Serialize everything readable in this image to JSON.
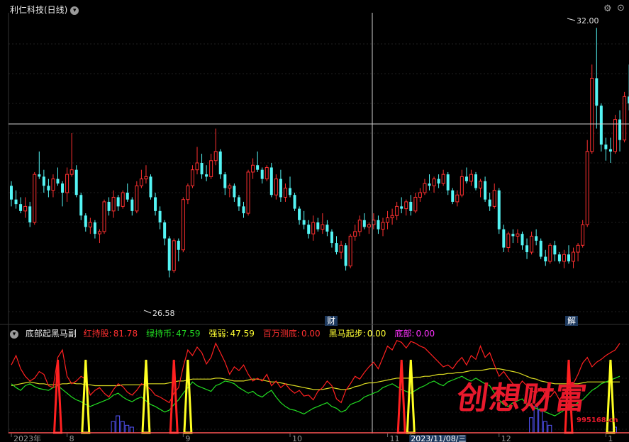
{
  "header": {
    "title": "利仁科技(日线)"
  },
  "sub_header": {
    "name": "底部起黑马副",
    "items": [
      {
        "label": "红持股:",
        "value": "81.78",
        "color": "#ff3030"
      },
      {
        "label": "绿持币:",
        "value": "47.59",
        "color": "#22dd22"
      },
      {
        "label": "强弱:",
        "value": "47.59",
        "color": "#ffff33"
      },
      {
        "label": "百万测底:",
        "value": "0.00",
        "color": "#ff3030"
      },
      {
        "label": "黑马起步:",
        "value": "0.00",
        "color": "#ffff33"
      },
      {
        "label": "底部:",
        "value": "0.00",
        "color": "#ff33ff"
      }
    ]
  },
  "events": {
    "e1": "财",
    "e2": "解"
  },
  "watermark": {
    "text": "创想财富",
    "url": "995168.cn"
  },
  "chart_data": {
    "type": "candlestick",
    "y_range": [
      25.8,
      32.3
    ],
    "high_label": "32.00",
    "low_label": "26.58",
    "x_ticks": [
      {
        "label": "2023年",
        "index": 0
      },
      {
        "label": "8",
        "index": 12
      },
      {
        "label": "9",
        "index": 37
      },
      {
        "label": "10",
        "index": 60
      },
      {
        "label": "11",
        "index": 81
      },
      {
        "label": "2023/11/08/三",
        "index": 86
      },
      {
        "label": "12",
        "index": 105
      },
      {
        "label": "1",
        "index": 128
      }
    ],
    "colors": {
      "up": "#ff3030",
      "down": "#54f5f5",
      "rsi_red": "#ff2020",
      "rsi_green": "#22dd22",
      "yellow": "#dddd22",
      "blue": "#5555ff"
    },
    "ohlc": [
      [
        28.55,
        28.65,
        28.1,
        28.25
      ],
      [
        28.25,
        28.45,
        28.05,
        28.15
      ],
      [
        28.15,
        28.3,
        27.95,
        28.0
      ],
      [
        28.0,
        28.3,
        27.85,
        28.1
      ],
      [
        28.1,
        28.2,
        27.65,
        27.75
      ],
      [
        27.75,
        28.85,
        27.7,
        28.8
      ],
      [
        28.8,
        29.3,
        28.7,
        28.75
      ],
      [
        28.75,
        28.9,
        28.4,
        28.55
      ],
      [
        28.55,
        28.7,
        28.3,
        28.45
      ],
      [
        28.45,
        28.8,
        28.3,
        28.7
      ],
      [
        28.7,
        28.95,
        28.55,
        28.6
      ],
      [
        28.6,
        28.65,
        28.1,
        28.4
      ],
      [
        28.4,
        28.95,
        28.2,
        28.8
      ],
      [
        28.8,
        29.7,
        28.75,
        28.9
      ],
      [
        28.9,
        29.0,
        28.3,
        28.35
      ],
      [
        28.35,
        28.4,
        27.8,
        27.9
      ],
      [
        27.9,
        27.95,
        27.55,
        27.65
      ],
      [
        27.65,
        27.85,
        27.5,
        27.75
      ],
      [
        27.75,
        27.8,
        27.4,
        27.5
      ],
      [
        27.5,
        27.6,
        27.3,
        27.55
      ],
      [
        27.55,
        28.25,
        27.5,
        28.2
      ],
      [
        28.2,
        28.3,
        27.9,
        28.0
      ],
      [
        28.0,
        28.45,
        27.85,
        28.3
      ],
      [
        28.3,
        28.35,
        28.0,
        28.1
      ],
      [
        28.1,
        28.45,
        28.05,
        28.4
      ],
      [
        28.4,
        28.6,
        28.2,
        28.25
      ],
      [
        28.25,
        28.3,
        27.9,
        28.0
      ],
      [
        28.0,
        28.65,
        27.95,
        28.55
      ],
      [
        28.55,
        28.9,
        28.5,
        28.7
      ],
      [
        28.7,
        29.0,
        28.6,
        28.75
      ],
      [
        28.75,
        28.8,
        28.25,
        28.3
      ],
      [
        28.3,
        28.4,
        27.9,
        28.0
      ],
      [
        28.0,
        28.1,
        27.6,
        27.75
      ],
      [
        27.75,
        27.8,
        27.25,
        27.4
      ],
      [
        27.4,
        27.45,
        26.55,
        26.7
      ],
      [
        26.7,
        27.4,
        26.65,
        27.35
      ],
      [
        27.35,
        27.4,
        26.9,
        27.15
      ],
      [
        27.15,
        28.3,
        27.1,
        28.25
      ],
      [
        28.25,
        28.6,
        28.15,
        28.55
      ],
      [
        28.55,
        29.0,
        28.5,
        28.9
      ],
      [
        28.9,
        29.4,
        28.8,
        29.05
      ],
      [
        29.05,
        29.25,
        28.7,
        28.8
      ],
      [
        28.8,
        29.0,
        28.65,
        28.75
      ],
      [
        28.75,
        29.25,
        28.7,
        29.1
      ],
      [
        29.1,
        29.8,
        29.0,
        29.3
      ],
      [
        29.3,
        29.35,
        28.7,
        28.8
      ],
      [
        28.8,
        28.85,
        28.35,
        28.5
      ],
      [
        28.5,
        28.6,
        28.3,
        28.55
      ],
      [
        28.55,
        28.6,
        28.2,
        28.3
      ],
      [
        28.3,
        28.35,
        28.0,
        28.1
      ],
      [
        28.1,
        28.2,
        27.85,
        27.95
      ],
      [
        27.95,
        28.9,
        27.9,
        28.85
      ],
      [
        28.85,
        29.15,
        28.7,
        29.0
      ],
      [
        29.0,
        29.3,
        28.85,
        28.9
      ],
      [
        28.9,
        28.95,
        28.6,
        28.7
      ],
      [
        28.7,
        29.0,
        28.65,
        28.95
      ],
      [
        28.95,
        29.05,
        28.3,
        28.35
      ],
      [
        28.35,
        28.8,
        28.25,
        28.7
      ],
      [
        28.7,
        28.9,
        28.2,
        28.3
      ],
      [
        28.3,
        28.6,
        28.2,
        28.5
      ],
      [
        28.5,
        28.75,
        28.3,
        28.35
      ],
      [
        28.35,
        28.4,
        28.0,
        28.05
      ],
      [
        28.05,
        28.1,
        27.7,
        27.8
      ],
      [
        27.8,
        28.0,
        27.6,
        27.7
      ],
      [
        27.7,
        27.8,
        27.4,
        27.5
      ],
      [
        27.5,
        27.9,
        27.35,
        27.75
      ],
      [
        27.75,
        27.85,
        27.55,
        27.6
      ],
      [
        27.6,
        27.95,
        27.5,
        27.7
      ],
      [
        27.7,
        27.8,
        27.45,
        27.55
      ],
      [
        27.55,
        27.6,
        27.2,
        27.3
      ],
      [
        27.3,
        27.45,
        27.05,
        27.1
      ],
      [
        27.1,
        27.35,
        26.95,
        27.25
      ],
      [
        27.25,
        27.3,
        26.7,
        26.8
      ],
      [
        26.8,
        27.5,
        26.75,
        27.45
      ],
      [
        27.45,
        27.7,
        27.35,
        27.55
      ],
      [
        27.55,
        27.9,
        27.45,
        27.8
      ],
      [
        27.8,
        27.95,
        27.6,
        27.65
      ],
      [
        27.65,
        27.75,
        27.5,
        27.7
      ],
      [
        27.7,
        27.95,
        27.6,
        27.8
      ],
      [
        27.8,
        27.9,
        27.5,
        27.6
      ],
      [
        27.6,
        27.85,
        27.45,
        27.75
      ],
      [
        27.75,
        28.0,
        27.6,
        27.85
      ],
      [
        27.85,
        28.05,
        27.7,
        27.9
      ],
      [
        27.9,
        28.2,
        27.8,
        28.1
      ],
      [
        28.1,
        28.3,
        27.95,
        28.05
      ],
      [
        28.05,
        28.25,
        27.9,
        28.2
      ],
      [
        28.2,
        28.35,
        27.9,
        28.0
      ],
      [
        28.0,
        28.4,
        27.95,
        28.3
      ],
      [
        28.3,
        28.5,
        28.2,
        28.4
      ],
      [
        28.4,
        28.7,
        28.35,
        28.6
      ],
      [
        28.6,
        28.8,
        28.45,
        28.55
      ],
      [
        28.55,
        28.75,
        28.4,
        28.7
      ],
      [
        28.7,
        28.8,
        28.5,
        28.6
      ],
      [
        28.6,
        28.9,
        28.55,
        28.8
      ],
      [
        28.8,
        28.85,
        28.35,
        28.45
      ],
      [
        28.45,
        28.5,
        28.15,
        28.2
      ],
      [
        28.2,
        28.45,
        28.1,
        28.35
      ],
      [
        28.35,
        28.9,
        28.3,
        28.75
      ],
      [
        28.75,
        28.95,
        28.6,
        28.65
      ],
      [
        28.65,
        28.9,
        28.55,
        28.8
      ],
      [
        28.8,
        28.85,
        28.45,
        28.5
      ],
      [
        28.5,
        28.7,
        28.3,
        28.65
      ],
      [
        28.65,
        28.75,
        28.2,
        28.25
      ],
      [
        28.25,
        28.4,
        28.0,
        28.1
      ],
      [
        28.1,
        28.6,
        28.05,
        28.45
      ],
      [
        28.45,
        28.5,
        27.5,
        27.6
      ],
      [
        27.6,
        27.7,
        27.1,
        27.2
      ],
      [
        27.2,
        27.55,
        27.1,
        27.5
      ],
      [
        27.5,
        27.6,
        27.3,
        27.45
      ],
      [
        27.45,
        27.6,
        27.3,
        27.5
      ],
      [
        27.5,
        27.55,
        27.15,
        27.25
      ],
      [
        27.25,
        27.4,
        26.95,
        27.1
      ],
      [
        27.1,
        27.55,
        27.05,
        27.45
      ],
      [
        27.45,
        27.6,
        27.25,
        27.35
      ],
      [
        27.35,
        27.4,
        26.95,
        27.0
      ],
      [
        27.0,
        27.15,
        26.8,
        26.9
      ],
      [
        26.9,
        27.3,
        26.85,
        27.25
      ],
      [
        27.25,
        27.35,
        26.9,
        27.05
      ],
      [
        27.05,
        27.1,
        26.85,
        26.9
      ],
      [
        26.9,
        27.15,
        26.75,
        27.05
      ],
      [
        27.05,
        27.25,
        26.85,
        26.9
      ],
      [
        26.9,
        27.2,
        26.75,
        27.1
      ],
      [
        27.1,
        27.3,
        26.9,
        27.25
      ],
      [
        27.25,
        27.8,
        27.2,
        27.7
      ],
      [
        27.7,
        29.55,
        27.65,
        29.3
      ],
      [
        29.3,
        31.2,
        29.25,
        30.9
      ],
      [
        30.9,
        32.0,
        29.8,
        30.3
      ],
      [
        30.3,
        30.35,
        29.3,
        29.45
      ],
      [
        29.45,
        29.6,
        29.1,
        29.35
      ],
      [
        29.35,
        29.6,
        29.05,
        29.3
      ],
      [
        29.3,
        30.1,
        29.25,
        30.0
      ],
      [
        30.0,
        30.2,
        29.3,
        29.55
      ],
      [
        29.55,
        30.6,
        29.5,
        30.5
      ],
      [
        30.5,
        31.2,
        30.2,
        30.35
      ],
      [
        30.35,
        31.3,
        29.7,
        31.25
      ]
    ],
    "rsi_red": [
      72,
      82,
      68,
      60,
      55,
      58,
      65,
      62,
      50,
      48,
      80,
      88,
      60,
      52,
      55,
      60,
      57,
      40,
      45,
      48,
      42,
      38,
      46,
      52,
      49,
      43,
      40,
      45,
      52,
      50,
      46,
      40,
      38,
      35,
      32,
      42,
      48,
      70,
      88,
      82,
      91,
      85,
      73,
      80,
      95,
      85,
      75,
      62,
      70,
      66,
      72,
      62,
      55,
      58,
      55,
      62,
      50,
      55,
      48,
      52,
      46,
      42,
      45,
      39,
      40,
      35,
      44,
      48,
      55,
      50,
      36,
      32,
      45,
      52,
      60,
      57,
      64,
      70,
      75,
      68,
      80,
      92,
      88,
      98,
      96,
      90,
      97,
      95,
      92,
      90,
      85,
      80,
      75,
      70,
      72,
      68,
      75,
      80,
      72,
      82,
      78,
      92,
      80,
      85,
      72,
      60,
      65,
      58,
      52,
      48,
      55,
      50,
      45,
      42,
      48,
      40,
      38,
      44,
      35,
      42,
      48,
      52,
      62,
      74,
      80,
      70,
      75,
      78,
      82,
      85,
      88,
      95
    ],
    "rsi_green": [
      52,
      48,
      45,
      50,
      52,
      49,
      47,
      46,
      45,
      48,
      50,
      46,
      42,
      38,
      35,
      33,
      30,
      28,
      30,
      32,
      34,
      36,
      40,
      42,
      38,
      35,
      33,
      36,
      38,
      34,
      30,
      28,
      25,
      22,
      24,
      30,
      35,
      42,
      48,
      54,
      50,
      48,
      46,
      44,
      50,
      52,
      55,
      54,
      52,
      48,
      45,
      42,
      44,
      40,
      38,
      42,
      45,
      38,
      32,
      28,
      25,
      24,
      22,
      20,
      23,
      26,
      28,
      30,
      32,
      28,
      26,
      22,
      24,
      30,
      32,
      34,
      38,
      40,
      42,
      44,
      48,
      50,
      52,
      49,
      46,
      44,
      42,
      45,
      48,
      50,
      53,
      55,
      52,
      50,
      54,
      56,
      58,
      60,
      57,
      55,
      58,
      55,
      52,
      50,
      42,
      35,
      30,
      28,
      32,
      34,
      36,
      30,
      28,
      26,
      24,
      22,
      20,
      18,
      21,
      24,
      26,
      28,
      32,
      35,
      40,
      45,
      48,
      52,
      54,
      56,
      58,
      60
    ],
    "strength": [
      50,
      51,
      52,
      53,
      54,
      53,
      52,
      52,
      51,
      51,
      51,
      52,
      52,
      53,
      52,
      52,
      51,
      51,
      50,
      50,
      50,
      50,
      50,
      50,
      51,
      51,
      51,
      51,
      51,
      52,
      52,
      52,
      52,
      52,
      53,
      54,
      55,
      55,
      56,
      57,
      57,
      57,
      57,
      57,
      58,
      58,
      57,
      56,
      55,
      55,
      55,
      56,
      57,
      57,
      56,
      55,
      54,
      54,
      53,
      52,
      51,
      50,
      49,
      48,
      47,
      46,
      46,
      46,
      47,
      48,
      47,
      46,
      46,
      47,
      49,
      50,
      52,
      53,
      53,
      54,
      55,
      56,
      57,
      58,
      58,
      58,
      58,
      59,
      59,
      60,
      60,
      61,
      62,
      62,
      63,
      63,
      64,
      64,
      65,
      66,
      66,
      66,
      67,
      68,
      68,
      68,
      67,
      66,
      65,
      64,
      62,
      60,
      58,
      57,
      55,
      54,
      53,
      52,
      52,
      52,
      52,
      52,
      52,
      53,
      54,
      54,
      54,
      54,
      54,
      54,
      54,
      54
    ],
    "spike_red_index": [
      10,
      35,
      84,
      120
    ],
    "spike_yellow_index": [
      16,
      29,
      38,
      86,
      129
    ],
    "blue_bars": [
      {
        "index": 22,
        "value": 0.12
      },
      {
        "index": 23,
        "value": 0.18
      },
      {
        "index": 24,
        "value": 0.12
      },
      {
        "index": 25,
        "value": 0.08
      },
      {
        "index": 26,
        "value": 0.06
      },
      {
        "index": 112,
        "value": 0.16
      },
      {
        "index": 113,
        "value": 0.28
      },
      {
        "index": 114,
        "value": 0.24
      },
      {
        "index": 115,
        "value": 0.12
      },
      {
        "index": 116,
        "value": 0.08
      },
      {
        "index": 130,
        "value": 0.06
      }
    ]
  }
}
